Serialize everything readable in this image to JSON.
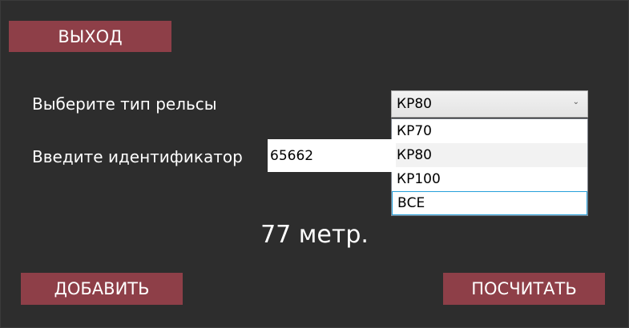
{
  "buttons": {
    "exit": "ВЫХОД",
    "add": "ДОБАВИТЬ",
    "calculate": "ПОСЧИТАТЬ"
  },
  "labels": {
    "rail_type": "Выберите тип рельсы",
    "identifier": "Введите идентификатор"
  },
  "identifier_input": {
    "value": "65662"
  },
  "rail_type_combo": {
    "selected": "КР80",
    "chevron_icon": "chevron-down-icon",
    "options": [
      "КР70",
      "КР80",
      "КР100",
      "ВСЕ"
    ]
  },
  "result": {
    "text": "77 метр."
  },
  "colors": {
    "background": "#2d2d2d",
    "button": "#8e3f48",
    "highlight_border": "#26a0da"
  }
}
